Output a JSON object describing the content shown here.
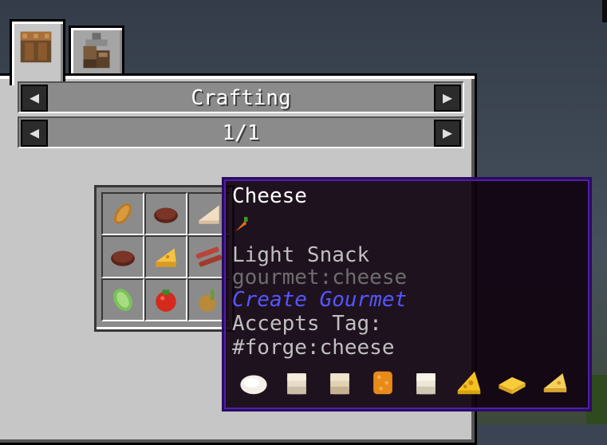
{
  "tabs": [
    {
      "name": "crafting-table-icon",
      "active": true
    },
    {
      "name": "machine-icon",
      "active": false
    }
  ],
  "header": {
    "category_title": "Crafting",
    "page_indicator": "1/1",
    "prev_arrow": "◀",
    "next_arrow": "▶"
  },
  "grid_items": [
    "bread-icon",
    "beef-patty-icon",
    "cheese-slice-icon",
    "beef-patty-icon",
    "cheese-wedge-icon",
    "bacon-icon",
    "lettuce-icon",
    "tomato-icon",
    "onion-icon"
  ],
  "tooltip": {
    "item_name": "Cheese",
    "category": "Light Snack",
    "registry_id": "gourmet:cheese",
    "mod_name": "Create Gourmet",
    "accepts_label": "Accepts Tag:",
    "tag": "#forge:cheese",
    "variant_icons": [
      "mozzarella-icon",
      "cheese-block-icon",
      "cheese-block-icon",
      "cheddar-icon",
      "cheese-block-icon",
      "swiss-cheese-icon",
      "cheese-slab-icon",
      "cheese-wedge-icon"
    ]
  },
  "colors": {
    "tooltip_bg": "#100210",
    "tooltip_border": "#4f1fa8",
    "mod_name": "#5555ff",
    "panel": "#c6c6c6"
  }
}
